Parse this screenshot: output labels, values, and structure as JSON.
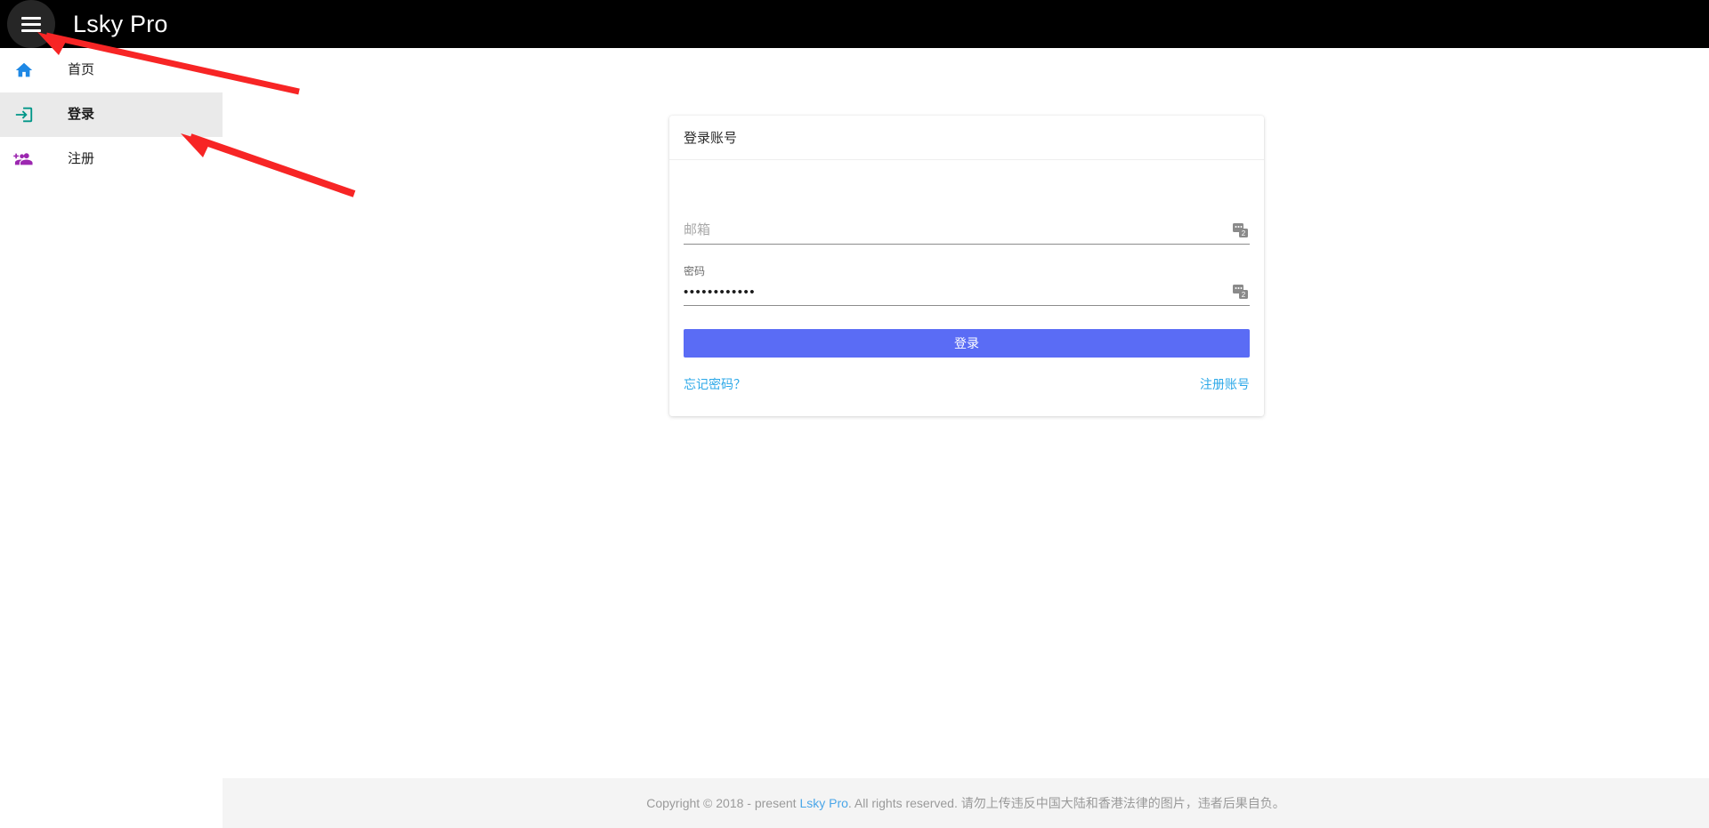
{
  "header": {
    "title": "Lsky Pro",
    "menu_icon": "hamburger-icon"
  },
  "sidebar": {
    "items": [
      {
        "label": "首页",
        "icon": "home-icon",
        "icon_color": "#1e88e5",
        "active": false
      },
      {
        "label": "登录",
        "icon": "login-icon",
        "icon_color": "#009688",
        "active": true
      },
      {
        "label": "注册",
        "icon": "person-add-icon",
        "icon_color": "#9c27b0",
        "active": false
      }
    ]
  },
  "login_card": {
    "header_title": "登录账号",
    "email_field": {
      "label": "",
      "placeholder": "邮箱",
      "value": "",
      "addon_icon": "password-manager-icon"
    },
    "password_field": {
      "label": "密码",
      "placeholder": "",
      "value": "••••••••••••",
      "addon_icon": "password-manager-icon"
    },
    "submit_label": "登录",
    "forgot_password_label": "忘记密码？",
    "register_label": "注册账号"
  },
  "footer": {
    "prefix": "Copyright © 2018 - present ",
    "brand": "Lsky Pro",
    "suffix": ". All rights reserved. 请勿上传违反中国大陆和香港法律的图片，违者后果自负。"
  },
  "colors": {
    "topbar_bg": "#000000",
    "accent_button": "#5a6cf5",
    "link_blue": "#2ca8e8",
    "sidebar_active_bg": "#eaeaea",
    "footer_bg": "#f4f4f4",
    "annotation_arrow": "#f72525"
  }
}
